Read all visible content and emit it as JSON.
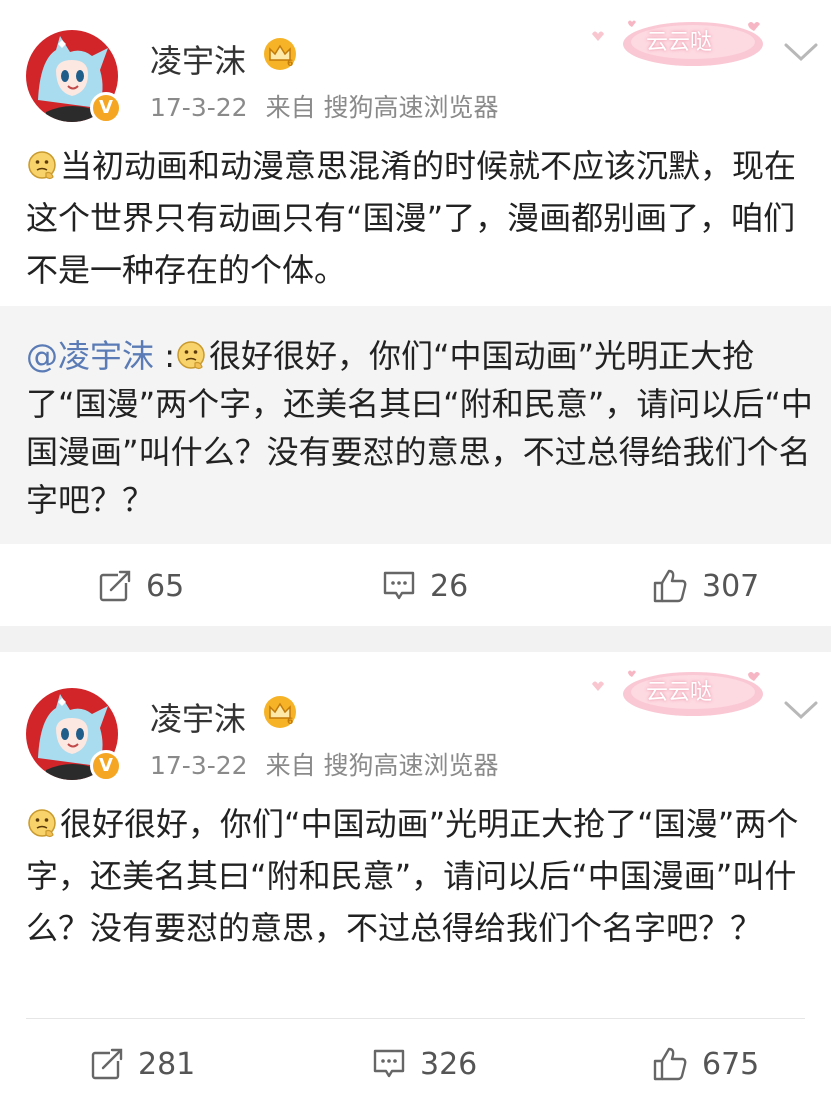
{
  "posts": [
    {
      "author": "凌宇沫",
      "date": "17-3-22",
      "source": "来自 搜狗高速浏览器",
      "sticker_text": "云云哒",
      "avatar_badge": "V",
      "text": "当初动画和动漫意思混淆的时候就不应该沉默，现在这个世界只有动画只有“国漫”了，漫画都别画了，咱们不是一种存在的个体。",
      "repost": {
        "mention": "@凌宇沫",
        "separator": " :",
        "text": "很好很好，你们“中国动画”光明正大抢了“国漫”两个字，还美名其曰“附和民意”，请问以后“中国漫画”叫什么？没有要怼的意思，不过总得给我们个名字吧？？"
      },
      "actions": {
        "repost": "65",
        "comments": "26",
        "likes": "307"
      }
    },
    {
      "author": "凌宇沫",
      "date": "17-3-22",
      "source": "来自 搜狗高速浏览器",
      "sticker_text": "云云哒",
      "avatar_badge": "V",
      "text": "很好很好，你们“中国动画”光明正大抢了“国漫”两个字，还美名其曰“附和民意”，请问以后“中国漫画”叫什么？没有要怼的意思，不过总得给我们个名字吧？？",
      "actions": {
        "repost": "281",
        "comments": "326",
        "likes": "675"
      }
    }
  ],
  "icons": {
    "emoji": "thinking-emoji-icon",
    "crown": "vip-crown-icon",
    "repost": "repost-icon",
    "comment": "comment-icon",
    "like": "thumbs-up-icon",
    "menu": "chevron-down-icon"
  },
  "colors": {
    "avatar_bg": "#d1252a",
    "verified_badge": "#f5a623",
    "mention": "#5a7bb5",
    "meta_text": "#8a8a8a",
    "repost_bg": "#f4f4f4",
    "separator_bg": "#f2f2f2",
    "sticker_pink": "#f7b6c3"
  }
}
